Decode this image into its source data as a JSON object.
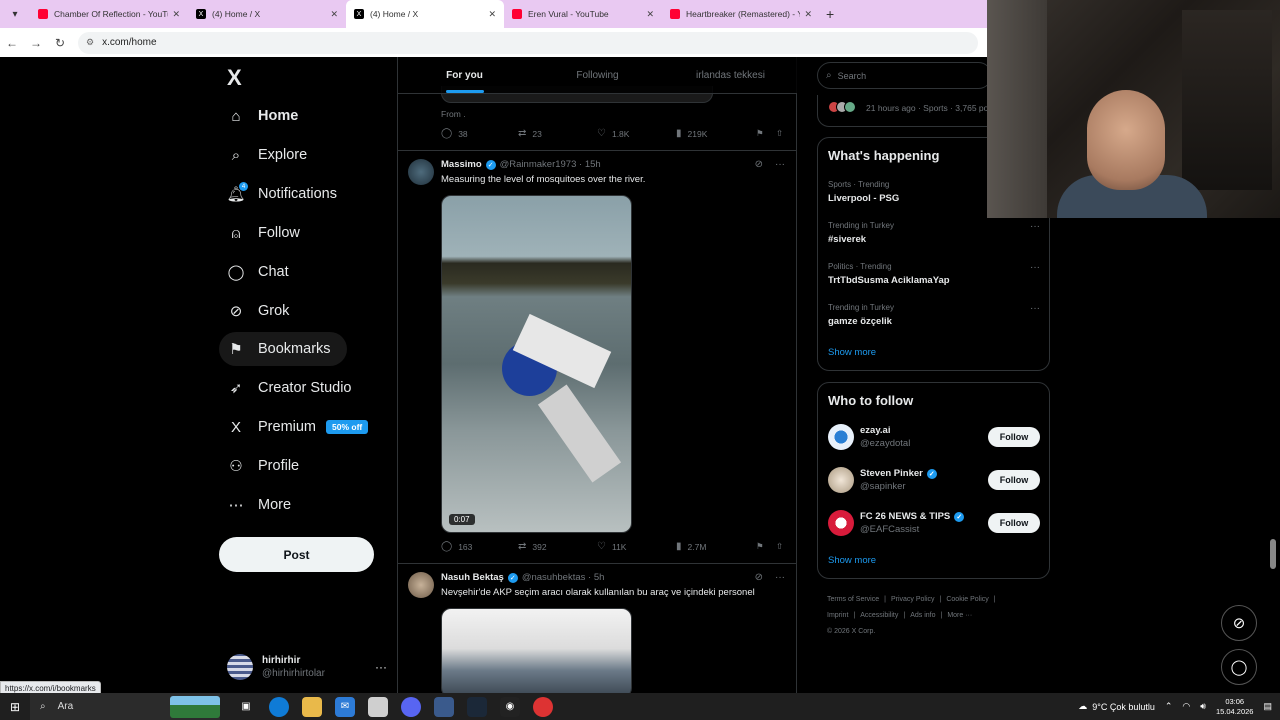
{
  "browser": {
    "tabs": [
      {
        "title": "Chamber Of Reflection - YouTube",
        "icon": "youtube-icon",
        "active": false
      },
      {
        "title": "(4) Home / X",
        "icon": "x-icon",
        "active": false
      },
      {
        "title": "(4) Home / X",
        "icon": "x-icon",
        "active": true
      },
      {
        "title": "Eren Vural - YouTube",
        "icon": "youtube-icon",
        "active": false
      },
      {
        "title": "Heartbreaker (Remastered) - YouTube",
        "icon": "youtube-icon",
        "active": false
      }
    ],
    "new_tab": "+",
    "url": "x.com/home",
    "status_url": "https://x.com/i/bookmarks"
  },
  "sidebar": {
    "logo": "X",
    "items": [
      {
        "label": "Home",
        "icon": "home-icon",
        "glyph": "⌂"
      },
      {
        "label": "Explore",
        "icon": "search-icon",
        "glyph": "⌕"
      },
      {
        "label": "Notifications",
        "icon": "bell-icon",
        "glyph": "🔔︎",
        "badge": "4"
      },
      {
        "label": "Follow",
        "icon": "add-user-icon",
        "glyph": "⍝"
      },
      {
        "label": "Chat",
        "icon": "chat-icon",
        "glyph": "◯"
      },
      {
        "label": "Grok",
        "icon": "grok-icon",
        "glyph": "⊘"
      },
      {
        "label": "Bookmarks",
        "icon": "bookmark-icon",
        "glyph": "⚑"
      },
      {
        "label": "Creator Studio",
        "icon": "rocket-icon",
        "glyph": "➶"
      },
      {
        "label": "Premium",
        "icon": "x-premium-icon",
        "glyph": "X",
        "badge": "50% off"
      },
      {
        "label": "Profile",
        "icon": "profile-icon",
        "glyph": "⚇"
      },
      {
        "label": "More",
        "icon": "more-circle-icon",
        "glyph": "⋯"
      }
    ],
    "post_label": "Post",
    "account": {
      "name": "hirhirhir",
      "handle": "@hirhirhirtolar"
    }
  },
  "feed": {
    "tabs": [
      "For you",
      "Following",
      "irlandas tekkesi"
    ],
    "prev_tweet": {
      "from_text": "From .",
      "replies": "38",
      "reposts": "23",
      "likes": "1.8K",
      "views": "219K"
    },
    "tweets": [
      {
        "name": "Massimo",
        "handle": "@Rainmaker1973",
        "time": "15h",
        "text": "Measuring the level of mosquitoes over the river.",
        "video_duration": "0:07",
        "replies": "163",
        "reposts": "392",
        "likes": "11K",
        "views": "2.7M"
      },
      {
        "name": "Nasuh Bektaş",
        "handle": "@nasuhbektas",
        "time": "5h",
        "text": "Nevşehir'de AKP seçim aracı olarak kullanılan bu araç ve içindeki personel"
      }
    ]
  },
  "right": {
    "search_placeholder": "Search",
    "top_card_meta": "21 hours ago · Sports · 3,765 po",
    "happening": {
      "title": "What's happening",
      "trends": [
        {
          "category": "Sports · Trending",
          "title": "Liverpool - PSG"
        },
        {
          "category": "Trending in Turkey",
          "title": "#siverek"
        },
        {
          "category": "Politics · Trending",
          "title": "TrtTbdSusma AciklamaYap"
        },
        {
          "category": "Trending in Turkey",
          "title": "gamze özçelik"
        }
      ],
      "show_more": "Show more"
    },
    "who_to_follow": {
      "title": "Who to follow",
      "accounts": [
        {
          "name": "ezay.ai",
          "handle": "@ezaydotal",
          "verified": false,
          "color": "#e8f1fb"
        },
        {
          "name": "Steven Pinker",
          "handle": "@sapinker",
          "verified": true,
          "color": "#d9cbb8"
        },
        {
          "name": "FC 26 NEWS & TIPS",
          "handle": "@EAFCassist",
          "verified": true,
          "color": "#d81b3b"
        }
      ],
      "follow_label": "Follow",
      "show_more": "Show more"
    },
    "footer": [
      "Terms of Service",
      "|",
      "Privacy Policy",
      "|",
      "Cookie Policy",
      "|",
      "Imprint",
      "|",
      "Accessibility",
      "|",
      "Ads info",
      "|",
      "More ···",
      "© 2026 X Corp."
    ]
  },
  "taskbar": {
    "search_label": "Ara",
    "weather": "9°C  Çok bulutlu",
    "time": "03:06",
    "date": "15.04.2026"
  },
  "colors": {
    "accent": "#1d9bf0",
    "tabbar": "#e9c9f2",
    "background": "#000000"
  }
}
